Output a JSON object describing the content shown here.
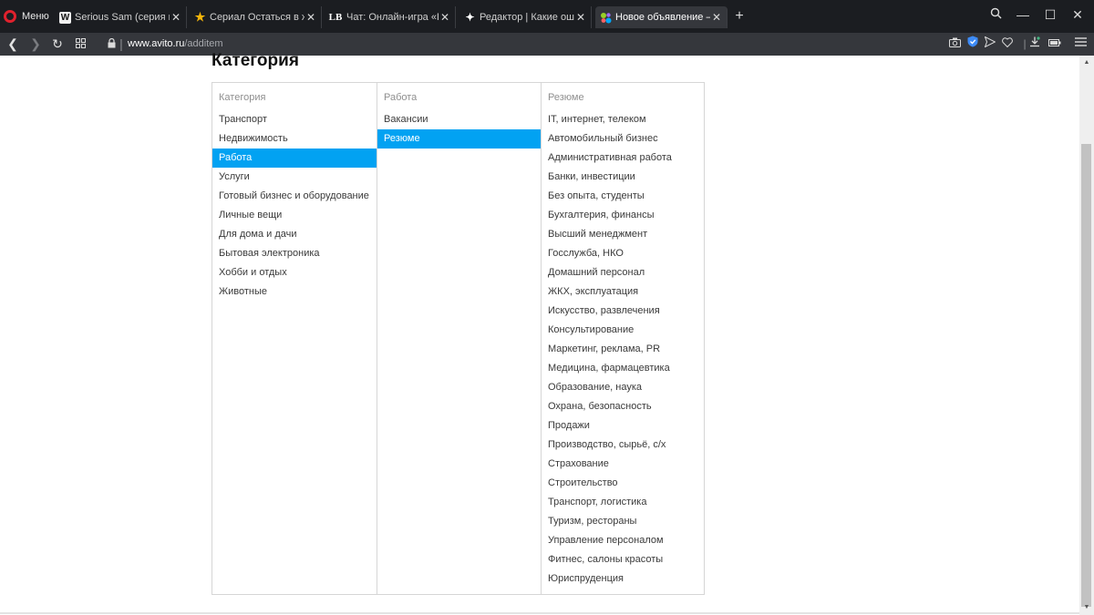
{
  "browser": {
    "menu_label": "Меню",
    "tabs": [
      {
        "title": "Serious Sam (серия игр) — Ви",
        "icon": "wikipedia-icon"
      },
      {
        "title": "Сериал Остаться в живых (Lo",
        "icon": "star-icon"
      },
      {
        "title": "Чат: Онлайн-игра «Последни",
        "icon": "lb-icon"
      },
      {
        "title": "Редактор | Какие ошибки за",
        "icon": "sparkle-icon"
      },
      {
        "title": "Новое объявление — Объявле",
        "icon": "avito-icon",
        "active": true
      }
    ],
    "url_host": "www.avito.ru",
    "url_path": "/additem"
  },
  "page": {
    "heading": "Категория",
    "columns": [
      {
        "title": "Категория",
        "selected": "Работа",
        "items": [
          "Транспорт",
          "Недвижимость",
          "Работа",
          "Услуги",
          "Готовый бизнес и оборудование",
          "Личные вещи",
          "Для дома и дачи",
          "Бытовая электроника",
          "Хобби и отдых",
          "Животные"
        ]
      },
      {
        "title": "Работа",
        "selected": "Резюме",
        "items": [
          "Вакансии",
          "Резюме"
        ]
      },
      {
        "title": "Резюме",
        "selected": null,
        "items": [
          "IT, интернет, телеком",
          "Автомобильный бизнес",
          "Административная работа",
          "Банки, инвестиции",
          "Без опыта, студенты",
          "Бухгалтерия, финансы",
          "Высший менеджмент",
          "Госслужба, НКО",
          "Домашний персонал",
          "ЖКХ, эксплуатация",
          "Искусство, развлечения",
          "Консультирование",
          "Маркетинг, реклама, PR",
          "Медицина, фармацевтика",
          "Образование, наука",
          "Охрана, безопасность",
          "Продажи",
          "Производство, сырьё, с/х",
          "Страхование",
          "Строительство",
          "Транспорт, логистика",
          "Туризм, рестораны",
          "Управление персоналом",
          "Фитнес, салоны красоты",
          "Юриспруденция"
        ]
      }
    ]
  },
  "colors": {
    "accent": "#02a2f2",
    "tabbar": "#1b1d21",
    "toolbar": "#35373c",
    "opera_red": "#e0212d"
  }
}
